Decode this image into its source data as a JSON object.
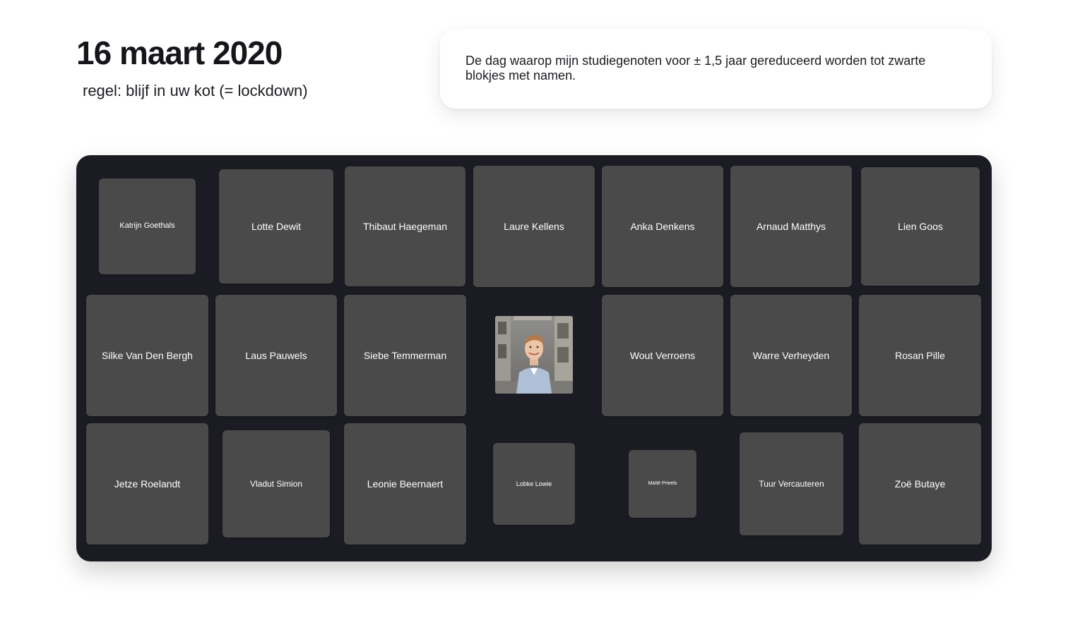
{
  "header": {
    "title": "16 maart 2020",
    "subtitle": "regel: blijf in uw kot (= lockdown)"
  },
  "info_card": {
    "text": "De dag waarop mijn studiegenoten voor ± 1,5 jaar gereduceerd worden tot zwarte blokjes met namen."
  },
  "grid": {
    "tiles": [
      {
        "name": "Katrijn Goethals"
      },
      {
        "name": "Lotte Dewit"
      },
      {
        "name": "Thibaut Haegeman"
      },
      {
        "name": "Laure Kellens"
      },
      {
        "name": "Anka Denkens"
      },
      {
        "name": "Arnaud Matthys"
      },
      {
        "name": "Lien Goos"
      },
      {
        "name": "Silke Van Den Bergh"
      },
      {
        "name": "Laus Pauwels"
      },
      {
        "name": "Siebe Temmerman"
      },
      {
        "name": "Wout Verroens"
      },
      {
        "name": "Warre Verheyden"
      },
      {
        "name": "Rosan Pille"
      },
      {
        "name": "Jetze Roelandt"
      },
      {
        "name": "Vladut Simion"
      },
      {
        "name": "Leonie Beernaert"
      },
      {
        "name": "Lobke Lowie"
      },
      {
        "name": "Maïté Prieels"
      },
      {
        "name": "Tuur Vercauteren"
      },
      {
        "name": "Zoë Butaye"
      }
    ]
  },
  "colors": {
    "board": "#1b1b23",
    "tile": "#4a4a4a",
    "tile_text": "#ffffff"
  },
  "icons": {
    "photo": "person-photo"
  }
}
